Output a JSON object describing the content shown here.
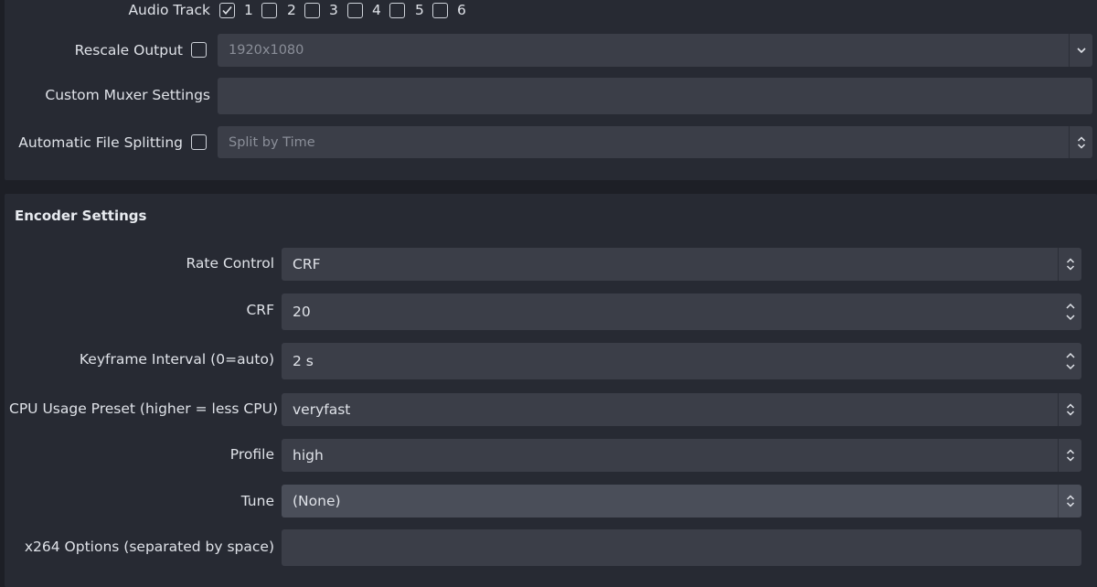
{
  "audio_track": {
    "label": "Audio Track",
    "tracks": [
      "1",
      "2",
      "3",
      "4",
      "5",
      "6"
    ],
    "checked": [
      true,
      false,
      false,
      false,
      false,
      false
    ]
  },
  "rescale_output": {
    "label": "Rescale Output",
    "checked": false,
    "value": "1920x1080",
    "icon": "chevron-down-icon"
  },
  "custom_muxer": {
    "label": "Custom Muxer Settings",
    "value": ""
  },
  "file_splitting": {
    "label": "Automatic File Splitting",
    "checked": false,
    "value": "Split by Time",
    "icon": "updown-icon"
  },
  "encoder_settings": {
    "title": "Encoder Settings",
    "rate_control": {
      "label": "Rate Control",
      "value": "CRF",
      "icon": "updown-icon"
    },
    "crf": {
      "label": "CRF",
      "value": "20",
      "icon": "spin-arrows-icon"
    },
    "keyframe_interval": {
      "label": "Keyframe Interval (0=auto)",
      "value": "2 s",
      "icon": "spin-arrows-icon"
    },
    "cpu_preset": {
      "label": "CPU Usage Preset (higher = less CPU)",
      "value": "veryfast",
      "icon": "updown-icon"
    },
    "profile": {
      "label": "Profile",
      "value": "high",
      "icon": "updown-icon"
    },
    "tune": {
      "label": "Tune",
      "value": "(None)",
      "icon": "updown-icon"
    },
    "x264_options": {
      "label": "x264 Options (separated by space)",
      "value": ""
    }
  },
  "colors": {
    "background": "#1d1f26",
    "panel": "#272a33",
    "field": "#3b3e48",
    "field_hover": "#4a4e59",
    "text": "#dfe2e8",
    "dim_text": "#8a8e98"
  }
}
